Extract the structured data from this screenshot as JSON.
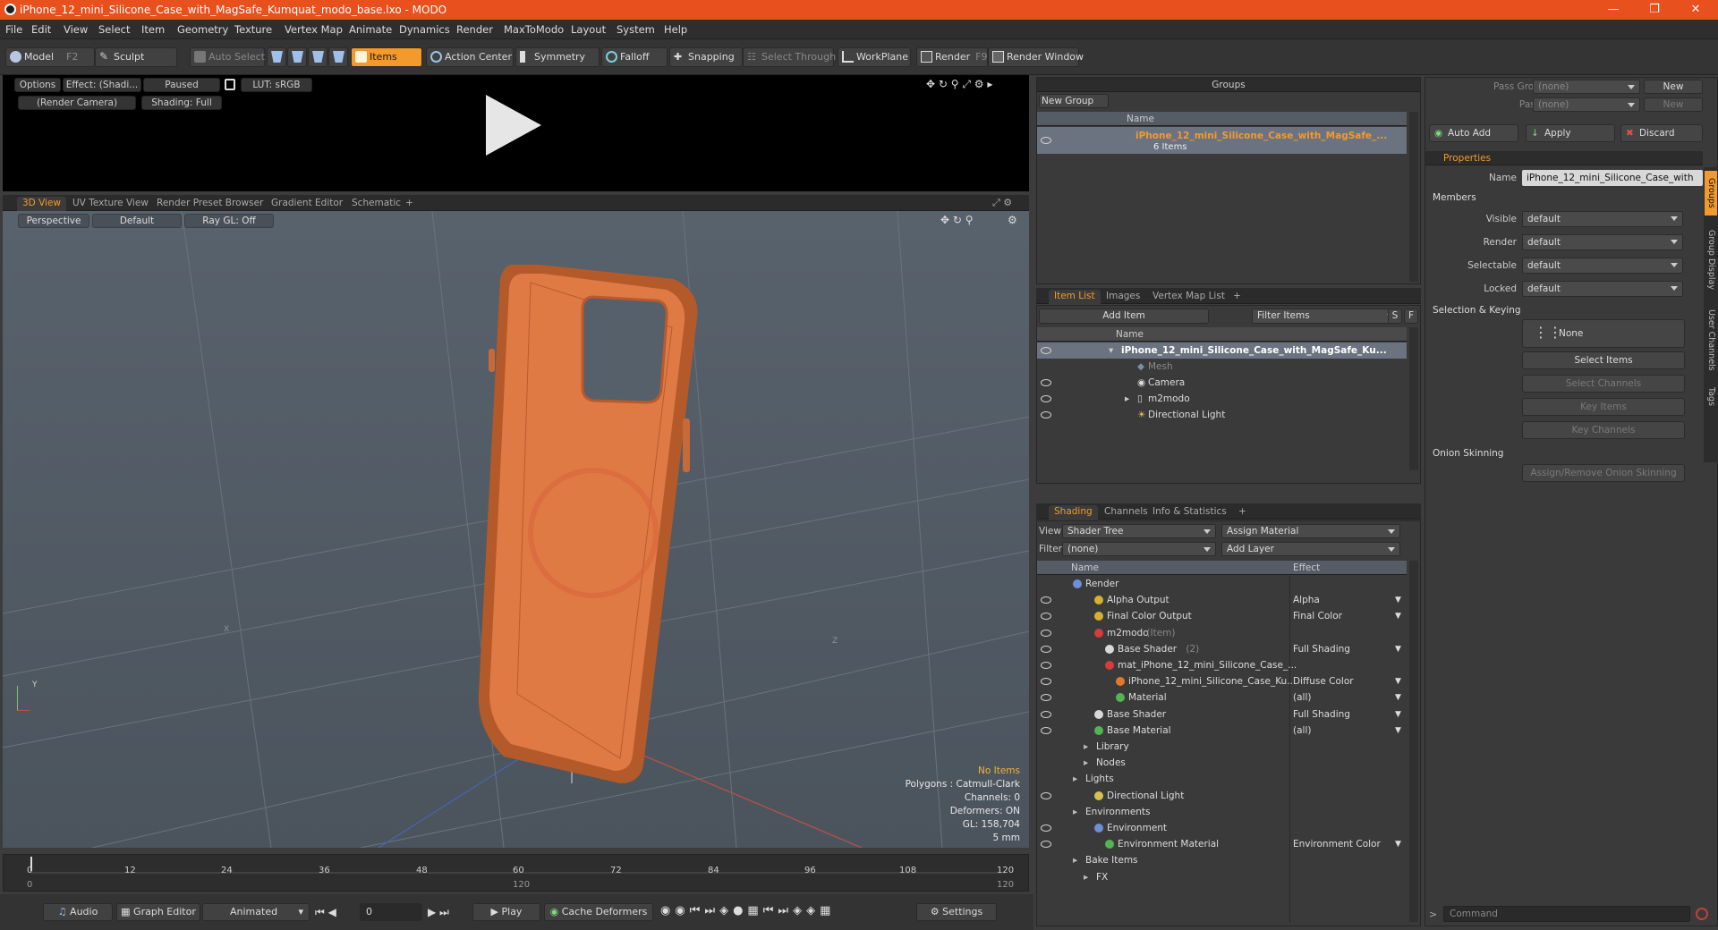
{
  "window": {
    "title": "iPhone_12_mini_Silicone_Case_with_MagSafe_Kumquat_modo_base.lxo - MODO"
  },
  "menu": [
    "File",
    "Edit",
    "View",
    "Select",
    "Item",
    "Geometry",
    "Texture",
    "Vertex Map",
    "Animate",
    "Dynamics",
    "Render",
    "MaxToModo",
    "Layout",
    "System",
    "Help"
  ],
  "toolbar": {
    "model": "Model",
    "model_key": "F2",
    "sculpt": "Sculpt",
    "auto_select": "Auto Select",
    "items": "Items",
    "action_center": "Action Center",
    "symmetry": "Symmetry",
    "falloff": "Falloff",
    "snapping": "Snapping",
    "select_through": "Select Through",
    "workplane": "WorkPlane",
    "render": "Render",
    "render_key": "F9",
    "render_window": "Render Window"
  },
  "preview": {
    "options": "Options",
    "effect": "Effect: (Shadi...",
    "paused": "Paused",
    "lut": "LUT: sRGB",
    "camera": "(Render Camera)",
    "shading": "Shading: Full"
  },
  "view_tabs": [
    "3D View",
    "UV Texture View",
    "Render Preset Browser",
    "Gradient Editor",
    "Schematic",
    "+"
  ],
  "viewport": {
    "perspective": "Perspective",
    "default": "Default",
    "raygl": "Ray GL: Off",
    "no_items": "No Items",
    "polygons": "Polygons : Catmull-Clark",
    "channels": "Channels: 0",
    "deformers": "Deformers: ON",
    "gl": "GL: 158,704",
    "scale": "5 mm",
    "axis_x": "X",
    "axis_y": "Y",
    "axis_z": "Z"
  },
  "timeline": {
    "ticks": [
      "0",
      "12",
      "24",
      "36",
      "48",
      "60",
      "72",
      "84",
      "96",
      "108",
      "120"
    ],
    "range_start": "0",
    "range_mid": "120",
    "range_end": "120"
  },
  "bottom": {
    "audio": "Audio",
    "graph_editor": "Graph Editor",
    "animated": "Animated",
    "frame": "0",
    "play": "Play",
    "cache_deformers": "Cache Deformers",
    "settings": "Settings"
  },
  "groups": {
    "title": "Groups",
    "new_group": "New Group",
    "name_col": "Name",
    "item_name": "iPhone_12_mini_Silicone_Case_with_MagSafe_...",
    "item_count": "6 Items"
  },
  "item_list": {
    "tabs": [
      "Item List",
      "Images",
      "Vertex Map List",
      "+"
    ],
    "add_item": "Add Item",
    "filter": "Filter Items",
    "s": "S",
    "f": "F",
    "name_col": "Name",
    "rows": [
      {
        "label": "iPhone_12_mini_Silicone_Case_with_MagSafe_Ku...",
        "indent": 0,
        "bold": true
      },
      {
        "label": "Mesh",
        "indent": 1,
        "dim": true
      },
      {
        "label": "Camera",
        "indent": 1
      },
      {
        "label": "m2modo",
        "indent": 1
      },
      {
        "label": "Directional Light",
        "indent": 1
      }
    ]
  },
  "shading": {
    "tabs": [
      "Shading",
      "Channels",
      "Info & Statistics",
      "+"
    ],
    "view_label": "View",
    "view_value": "Shader Tree",
    "assign_material": "Assign Material",
    "filter_label": "Filter",
    "filter_value": "(none)",
    "add_layer": "Add Layer",
    "name_col": "Name",
    "effect_col": "Effect",
    "rows": [
      {
        "label": "Render",
        "effect": "",
        "indent": 0,
        "color": "#6d8fd6"
      },
      {
        "label": "Alpha Output",
        "effect": "Alpha",
        "indent": 2,
        "color": "#d8b030"
      },
      {
        "label": "Final Color Output",
        "effect": "Final Color",
        "indent": 2,
        "color": "#d8b030"
      },
      {
        "label": "m2modo",
        "suffix": "(Item)",
        "effect": "",
        "indent": 2,
        "color": "#d63c3c"
      },
      {
        "label": "Base Shader",
        "suffix": "(2)",
        "effect": "Full Shading",
        "indent": 3,
        "color": "#d8d8d8"
      },
      {
        "label": "mat_iPhone_12_mini_Silicone_Case_...",
        "effect": "",
        "indent": 3,
        "color": "#d63c3c"
      },
      {
        "label": "iPhone_12_mini_Silicone_Case_Ku...",
        "effect": "Diffuse Color",
        "indent": 4,
        "color": "#e07a2a"
      },
      {
        "label": "Material",
        "effect": "(all)",
        "indent": 4,
        "color": "#52b552"
      },
      {
        "label": "Base Shader",
        "effect": "Full Shading",
        "indent": 2,
        "color": "#d8d8d8"
      },
      {
        "label": "Base Material",
        "effect": "(all)",
        "indent": 2,
        "color": "#52b552"
      },
      {
        "label": "Library",
        "effect": "",
        "indent": 1,
        "color": ""
      },
      {
        "label": "Nodes",
        "effect": "",
        "indent": 1,
        "color": ""
      },
      {
        "label": "Lights",
        "effect": "",
        "indent": 0,
        "color": ""
      },
      {
        "label": "Directional Light",
        "effect": "",
        "indent": 2,
        "color": "#d8c050"
      },
      {
        "label": "Environments",
        "effect": "",
        "indent": 0,
        "color": ""
      },
      {
        "label": "Environment",
        "effect": "",
        "indent": 2,
        "color": "#6d8fd6"
      },
      {
        "label": "Environment Material",
        "effect": "Environment Color",
        "indent": 3,
        "color": "#52b552"
      },
      {
        "label": "Bake Items",
        "effect": "",
        "indent": 0,
        "color": ""
      },
      {
        "label": "FX",
        "effect": "",
        "indent": 1,
        "color": ""
      }
    ]
  },
  "right": {
    "pass_groups": "Pass Groups",
    "passes": "Passes",
    "none": "(none)",
    "new": "New",
    "auto_add": "Auto Add",
    "apply": "Apply",
    "discard": "Discard",
    "properties": "Properties",
    "name_label": "Name",
    "name_value": "iPhone_12_mini_Silicone_Case_with",
    "members": "Members",
    "visible": "Visible",
    "render": "Render",
    "selectable": "Selectable",
    "locked": "Locked",
    "default": "default",
    "selection_keying": "Selection & Keying",
    "none_btn": "None",
    "select_items": "Select Items",
    "select_channels": "Select Channels",
    "key_items": "Key Items",
    "key_channels": "Key Channels",
    "onion": "Onion Skinning",
    "assign_onion": "Assign/Remove Onion Skinning",
    "side_tabs": [
      "Groups",
      "Group Display",
      "User Channels",
      "Tags"
    ],
    "command": "Command"
  }
}
